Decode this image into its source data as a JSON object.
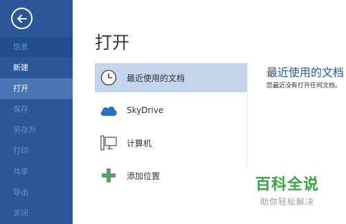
{
  "sidebar": {
    "items": [
      {
        "label": "信息"
      },
      {
        "label": "新建"
      },
      {
        "label": "打开"
      },
      {
        "label": "保存"
      },
      {
        "label": "另存为"
      },
      {
        "label": "打印"
      },
      {
        "label": "共享"
      },
      {
        "label": "导出"
      },
      {
        "label": "关闭"
      }
    ]
  },
  "main": {
    "title": "打开",
    "places": [
      {
        "label": "最近使用的文档",
        "icon": "clock-icon"
      },
      {
        "label": "SkyDrive",
        "icon": "cloud-icon"
      },
      {
        "label": "计算机",
        "icon": "computer-icon"
      },
      {
        "label": "添加位置",
        "icon": "plus-icon"
      }
    ],
    "recent": {
      "title": "最近使用的文档",
      "message": "您最近没有打开任何文档。"
    }
  },
  "watermark": {
    "brand": "百科全说",
    "slogan": "助你轻松解决"
  },
  "colors": {
    "sidebar": "#2b579a",
    "selected": "#c6d5ee",
    "accent": "#2b579a",
    "plus": "#5e9c76"
  }
}
